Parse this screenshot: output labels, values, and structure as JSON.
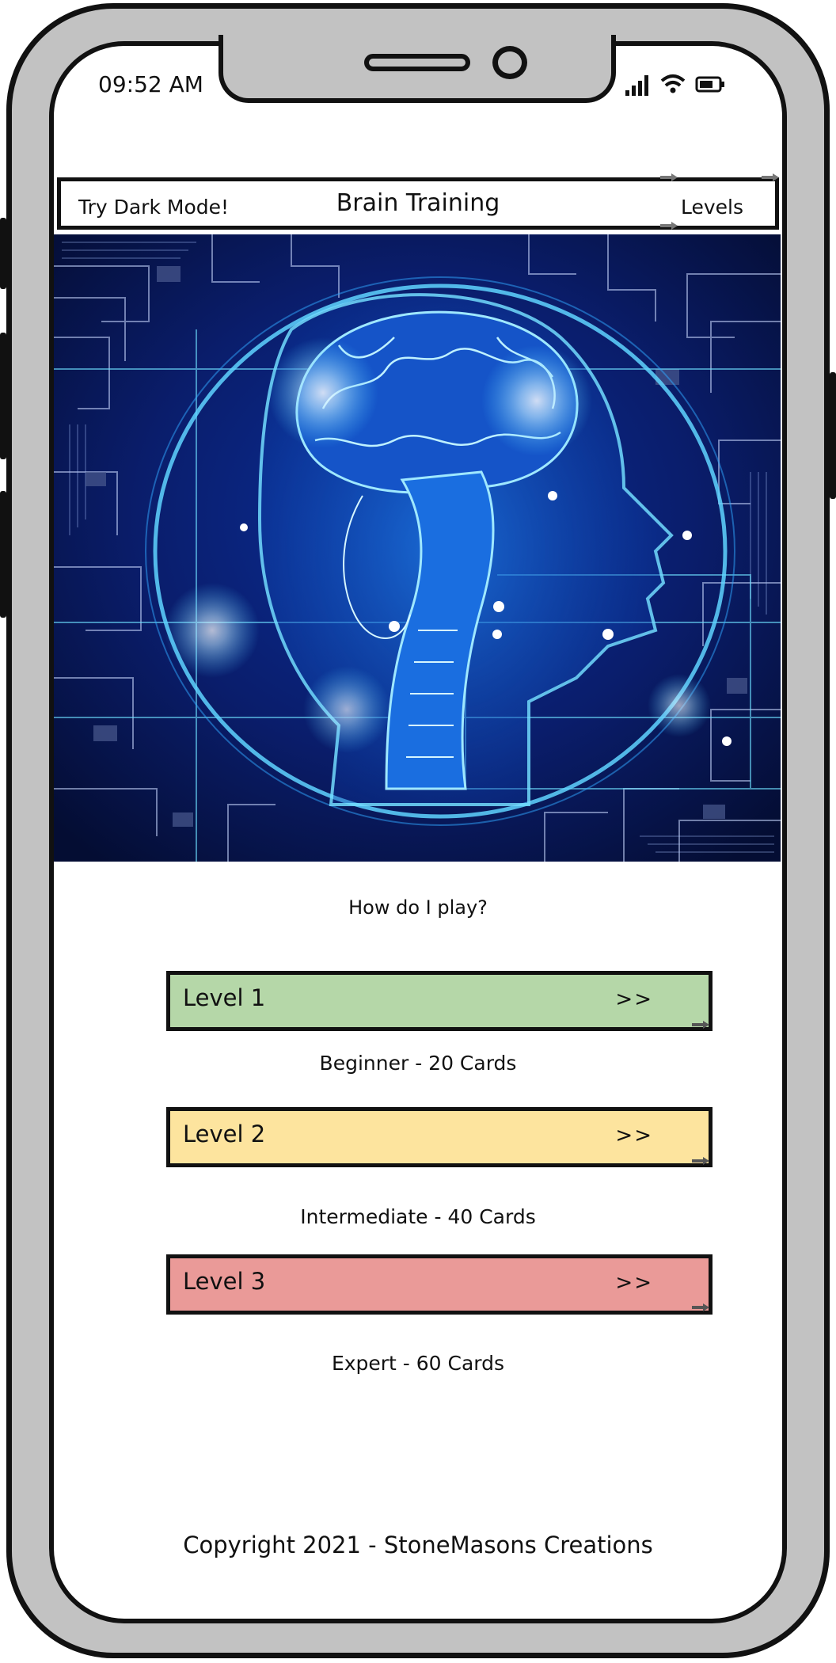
{
  "status_bar": {
    "time": "09:52 AM"
  },
  "header": {
    "dark_mode": "Try Dark Mode!",
    "title": "Brain Training",
    "levels": "Levels"
  },
  "main": {
    "howto": "How do I play?",
    "levels": [
      {
        "label": "Level 1",
        "go": ">>",
        "desc": "Beginner - 20 Cards",
        "color": "#b5d7a8"
      },
      {
        "label": "Level 2",
        "go": ">>",
        "desc": "Intermediate - 40 Cards",
        "color": "#fde49e"
      },
      {
        "label": "Level 3",
        "go": ">>",
        "desc": "Expert - 60 Cards",
        "color": "#ea9a98"
      }
    ]
  },
  "footer": {
    "copyright": "Copyright 2021 - StoneMasons Creations"
  },
  "colors": {
    "frame": "#c2c2c2",
    "outline": "#111111",
    "hero_bg": "#061549",
    "hero_glow": "#3fc4ff"
  },
  "icons": [
    "signal-icon",
    "wifi-icon",
    "battery-icon",
    "link-arrow-icon"
  ]
}
